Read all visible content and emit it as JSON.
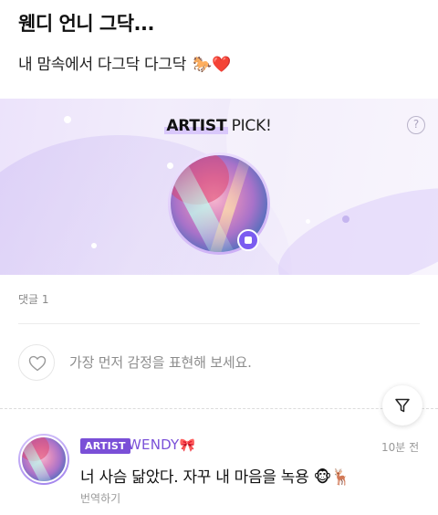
{
  "post": {
    "title": "웬디 언니 그닥...",
    "body": "내 맘속에서 다그닥 다그닥",
    "body_emoji": "🐎❤️"
  },
  "artist_pick": {
    "title_strong": "ARTIST",
    "title_light": " PICK!",
    "help_label": "?",
    "accent_color": "#7b5cf0"
  },
  "comments": {
    "count_label": "댓글 1",
    "reaction_prompt": "가장 먼저 감정을 표현해 보세요.",
    "items": [
      {
        "badge": "ARTIST",
        "author": "WENDY",
        "author_emoji": "🎀",
        "time": "10분 전",
        "text": "너 사슴 닮았다. 자꾸 내 마음을 녹용 🐵🦌",
        "translate_label": "번역하기"
      }
    ]
  },
  "colors": {
    "brand_purple": "#7a4fd7",
    "banner_bg": "#ece3fb",
    "muted_text": "#8d8d8d"
  },
  "icons": [
    "help-icon",
    "heart-icon",
    "filter-icon",
    "artist-verified-icon"
  ]
}
